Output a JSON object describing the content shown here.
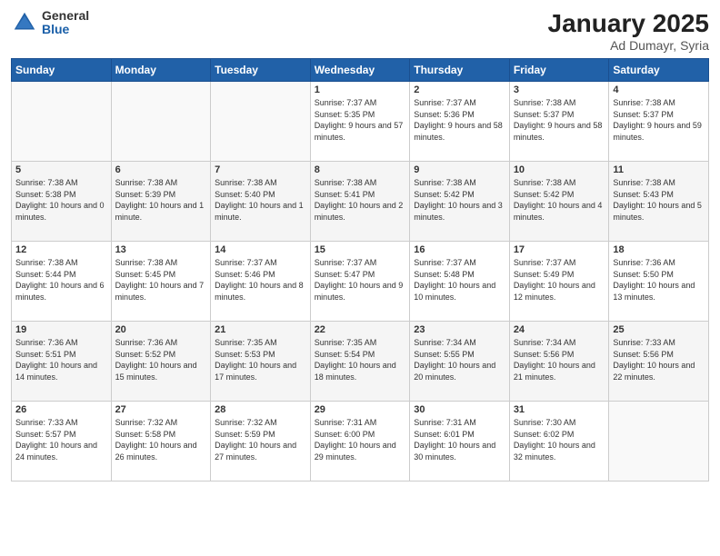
{
  "logo": {
    "general": "General",
    "blue": "Blue"
  },
  "title": "January 2025",
  "subtitle": "Ad Dumayr, Syria",
  "weekdays": [
    "Sunday",
    "Monday",
    "Tuesday",
    "Wednesday",
    "Thursday",
    "Friday",
    "Saturday"
  ],
  "weeks": [
    [
      {
        "day": "",
        "sunrise": "",
        "sunset": "",
        "daylight": ""
      },
      {
        "day": "",
        "sunrise": "",
        "sunset": "",
        "daylight": ""
      },
      {
        "day": "",
        "sunrise": "",
        "sunset": "",
        "daylight": ""
      },
      {
        "day": "1",
        "sunrise": "Sunrise: 7:37 AM",
        "sunset": "Sunset: 5:35 PM",
        "daylight": "Daylight: 9 hours and 57 minutes."
      },
      {
        "day": "2",
        "sunrise": "Sunrise: 7:37 AM",
        "sunset": "Sunset: 5:36 PM",
        "daylight": "Daylight: 9 hours and 58 minutes."
      },
      {
        "day": "3",
        "sunrise": "Sunrise: 7:38 AM",
        "sunset": "Sunset: 5:37 PM",
        "daylight": "Daylight: 9 hours and 58 minutes."
      },
      {
        "day": "4",
        "sunrise": "Sunrise: 7:38 AM",
        "sunset": "Sunset: 5:37 PM",
        "daylight": "Daylight: 9 hours and 59 minutes."
      }
    ],
    [
      {
        "day": "5",
        "sunrise": "Sunrise: 7:38 AM",
        "sunset": "Sunset: 5:38 PM",
        "daylight": "Daylight: 10 hours and 0 minutes."
      },
      {
        "day": "6",
        "sunrise": "Sunrise: 7:38 AM",
        "sunset": "Sunset: 5:39 PM",
        "daylight": "Daylight: 10 hours and 1 minute."
      },
      {
        "day": "7",
        "sunrise": "Sunrise: 7:38 AM",
        "sunset": "Sunset: 5:40 PM",
        "daylight": "Daylight: 10 hours and 1 minute."
      },
      {
        "day": "8",
        "sunrise": "Sunrise: 7:38 AM",
        "sunset": "Sunset: 5:41 PM",
        "daylight": "Daylight: 10 hours and 2 minutes."
      },
      {
        "day": "9",
        "sunrise": "Sunrise: 7:38 AM",
        "sunset": "Sunset: 5:42 PM",
        "daylight": "Daylight: 10 hours and 3 minutes."
      },
      {
        "day": "10",
        "sunrise": "Sunrise: 7:38 AM",
        "sunset": "Sunset: 5:42 PM",
        "daylight": "Daylight: 10 hours and 4 minutes."
      },
      {
        "day": "11",
        "sunrise": "Sunrise: 7:38 AM",
        "sunset": "Sunset: 5:43 PM",
        "daylight": "Daylight: 10 hours and 5 minutes."
      }
    ],
    [
      {
        "day": "12",
        "sunrise": "Sunrise: 7:38 AM",
        "sunset": "Sunset: 5:44 PM",
        "daylight": "Daylight: 10 hours and 6 minutes."
      },
      {
        "day": "13",
        "sunrise": "Sunrise: 7:38 AM",
        "sunset": "Sunset: 5:45 PM",
        "daylight": "Daylight: 10 hours and 7 minutes."
      },
      {
        "day": "14",
        "sunrise": "Sunrise: 7:37 AM",
        "sunset": "Sunset: 5:46 PM",
        "daylight": "Daylight: 10 hours and 8 minutes."
      },
      {
        "day": "15",
        "sunrise": "Sunrise: 7:37 AM",
        "sunset": "Sunset: 5:47 PM",
        "daylight": "Daylight: 10 hours and 9 minutes."
      },
      {
        "day": "16",
        "sunrise": "Sunrise: 7:37 AM",
        "sunset": "Sunset: 5:48 PM",
        "daylight": "Daylight: 10 hours and 10 minutes."
      },
      {
        "day": "17",
        "sunrise": "Sunrise: 7:37 AM",
        "sunset": "Sunset: 5:49 PM",
        "daylight": "Daylight: 10 hours and 12 minutes."
      },
      {
        "day": "18",
        "sunrise": "Sunrise: 7:36 AM",
        "sunset": "Sunset: 5:50 PM",
        "daylight": "Daylight: 10 hours and 13 minutes."
      }
    ],
    [
      {
        "day": "19",
        "sunrise": "Sunrise: 7:36 AM",
        "sunset": "Sunset: 5:51 PM",
        "daylight": "Daylight: 10 hours and 14 minutes."
      },
      {
        "day": "20",
        "sunrise": "Sunrise: 7:36 AM",
        "sunset": "Sunset: 5:52 PM",
        "daylight": "Daylight: 10 hours and 15 minutes."
      },
      {
        "day": "21",
        "sunrise": "Sunrise: 7:35 AM",
        "sunset": "Sunset: 5:53 PM",
        "daylight": "Daylight: 10 hours and 17 minutes."
      },
      {
        "day": "22",
        "sunrise": "Sunrise: 7:35 AM",
        "sunset": "Sunset: 5:54 PM",
        "daylight": "Daylight: 10 hours and 18 minutes."
      },
      {
        "day": "23",
        "sunrise": "Sunrise: 7:34 AM",
        "sunset": "Sunset: 5:55 PM",
        "daylight": "Daylight: 10 hours and 20 minutes."
      },
      {
        "day": "24",
        "sunrise": "Sunrise: 7:34 AM",
        "sunset": "Sunset: 5:56 PM",
        "daylight": "Daylight: 10 hours and 21 minutes."
      },
      {
        "day": "25",
        "sunrise": "Sunrise: 7:33 AM",
        "sunset": "Sunset: 5:56 PM",
        "daylight": "Daylight: 10 hours and 22 minutes."
      }
    ],
    [
      {
        "day": "26",
        "sunrise": "Sunrise: 7:33 AM",
        "sunset": "Sunset: 5:57 PM",
        "daylight": "Daylight: 10 hours and 24 minutes."
      },
      {
        "day": "27",
        "sunrise": "Sunrise: 7:32 AM",
        "sunset": "Sunset: 5:58 PM",
        "daylight": "Daylight: 10 hours and 26 minutes."
      },
      {
        "day": "28",
        "sunrise": "Sunrise: 7:32 AM",
        "sunset": "Sunset: 5:59 PM",
        "daylight": "Daylight: 10 hours and 27 minutes."
      },
      {
        "day": "29",
        "sunrise": "Sunrise: 7:31 AM",
        "sunset": "Sunset: 6:00 PM",
        "daylight": "Daylight: 10 hours and 29 minutes."
      },
      {
        "day": "30",
        "sunrise": "Sunrise: 7:31 AM",
        "sunset": "Sunset: 6:01 PM",
        "daylight": "Daylight: 10 hours and 30 minutes."
      },
      {
        "day": "31",
        "sunrise": "Sunrise: 7:30 AM",
        "sunset": "Sunset: 6:02 PM",
        "daylight": "Daylight: 10 hours and 32 minutes."
      },
      {
        "day": "",
        "sunrise": "",
        "sunset": "",
        "daylight": ""
      }
    ]
  ]
}
